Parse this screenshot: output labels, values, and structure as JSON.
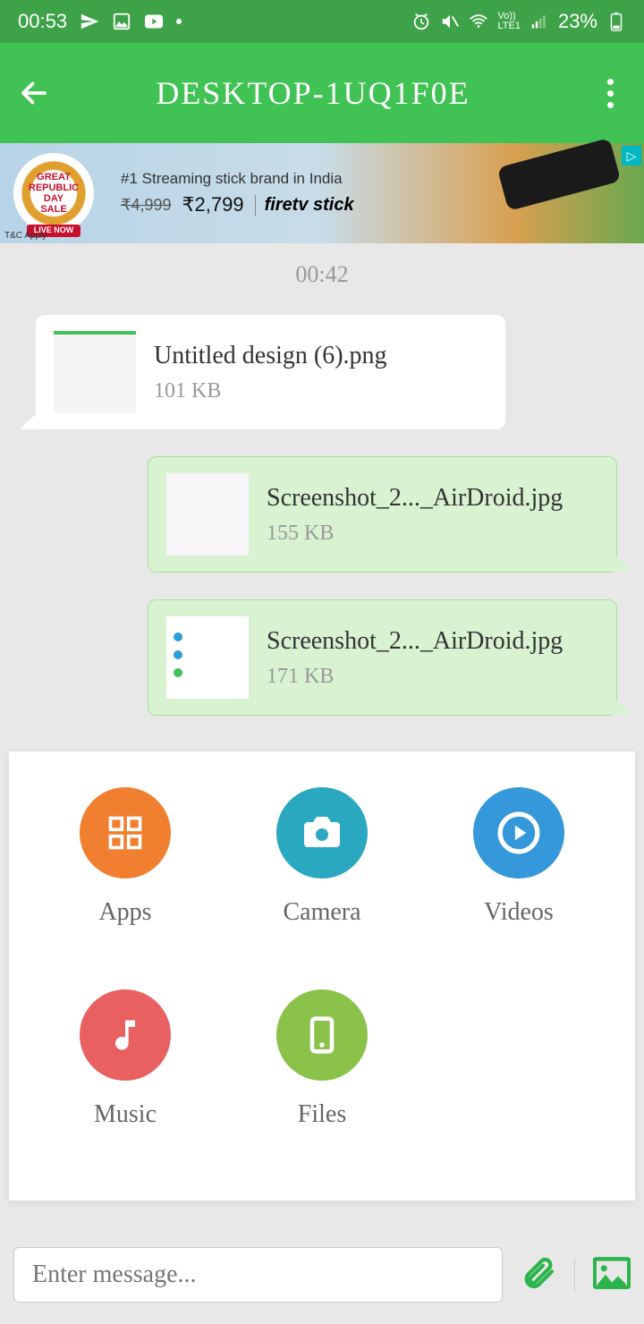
{
  "status": {
    "time": "00:53",
    "battery": "23%"
  },
  "header": {
    "title": "DESKTOP-1UQ1F0E"
  },
  "ad": {
    "badge_line1": "GREAT",
    "badge_line2": "REPUBLIC",
    "badge_line3": "DAY",
    "badge_line4": "SALE",
    "headline": "#1 Streaming stick brand in India",
    "price_old": "₹4,999",
    "price_new": "₹2,799",
    "brand": "firetv stick",
    "tc": "T&C Apply"
  },
  "chat": {
    "timestamp": "00:42",
    "messages": [
      {
        "name": "Untitled design (6).png",
        "size": "101 KB"
      },
      {
        "name": "Screenshot_2..._AirDroid.jpg",
        "size": "155 KB"
      },
      {
        "name": "Screenshot_2..._AirDroid.jpg",
        "size": "171 KB"
      }
    ]
  },
  "attachments": {
    "apps": "Apps",
    "camera": "Camera",
    "videos": "Videos",
    "music": "Music",
    "files": "Files"
  },
  "input": {
    "placeholder": "Enter message..."
  }
}
